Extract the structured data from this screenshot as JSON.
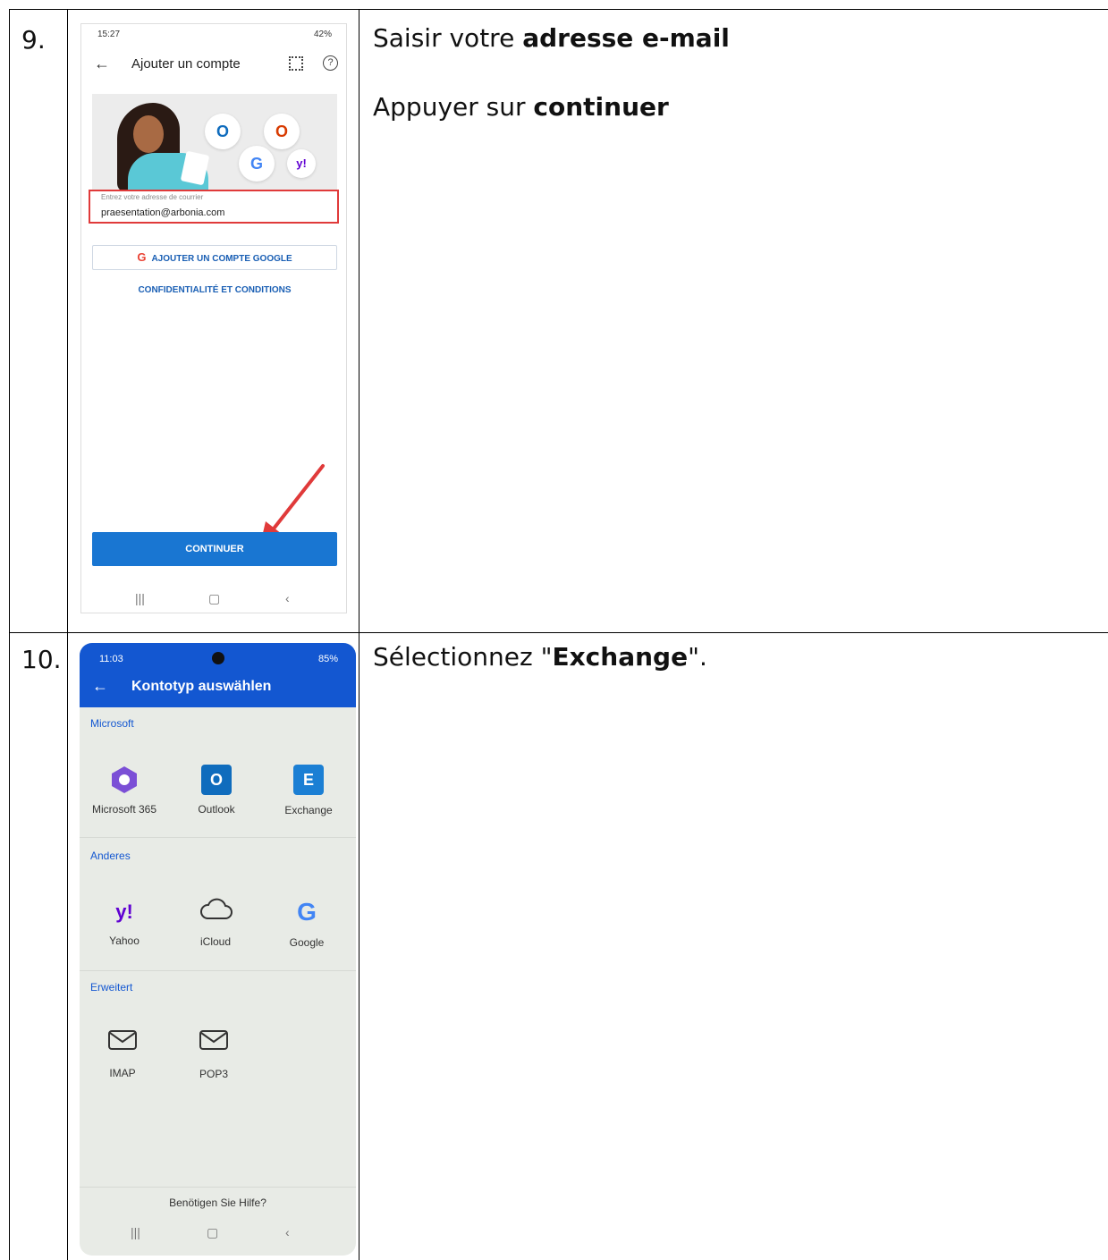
{
  "rows": [
    {
      "number": "9.",
      "instruction_1_pre": "Saisir votre ",
      "instruction_1_bold": "adresse e-mail",
      "instruction_2_pre": "Appuyer sur ",
      "instruction_2_bold": "continuer"
    },
    {
      "number": "10.",
      "instruction_pre": "Sélectionnez \"",
      "instruction_bold": "Exchange",
      "instruction_post": "\"."
    }
  ],
  "phone1": {
    "time": "15:27",
    "status_right": "42%",
    "title": "Ajouter un compte",
    "help_glyph": "?",
    "input_label": "Entrez votre adresse de courrier",
    "input_value": "praesentation@arbonia.com",
    "google_glyph": "G",
    "google_button": "AJOUTER UN COMPTE GOOGLE",
    "privacy_link": "CONFIDENTIALITÉ ET CONDITIONS",
    "continue_button": "CONTINUER",
    "logo_outlook": "O",
    "logo_office": "O",
    "logo_google": "G",
    "logo_yahoo": "y!"
  },
  "phone2": {
    "time": "11:03",
    "status_right": "85%",
    "title": "Kontotyp auswählen",
    "section_microsoft": "Microsoft",
    "microsoft_items": [
      "Microsoft 365",
      "Outlook",
      "Exchange"
    ],
    "section_other": "Anderes",
    "other_items": [
      "Yahoo",
      "iCloud",
      "Google"
    ],
    "section_advanced": "Erweitert",
    "advanced_items": [
      "IMAP",
      "POP3"
    ],
    "help": "Benötigen Sie Hilfe?",
    "icon_outlook": "O",
    "icon_exchange": "E",
    "icon_yahoo": "y!",
    "icon_google": "G"
  },
  "colors": {
    "accent": "#1976d2",
    "highlight": "#e03a3a",
    "phone2_bar": "#1357d1"
  }
}
